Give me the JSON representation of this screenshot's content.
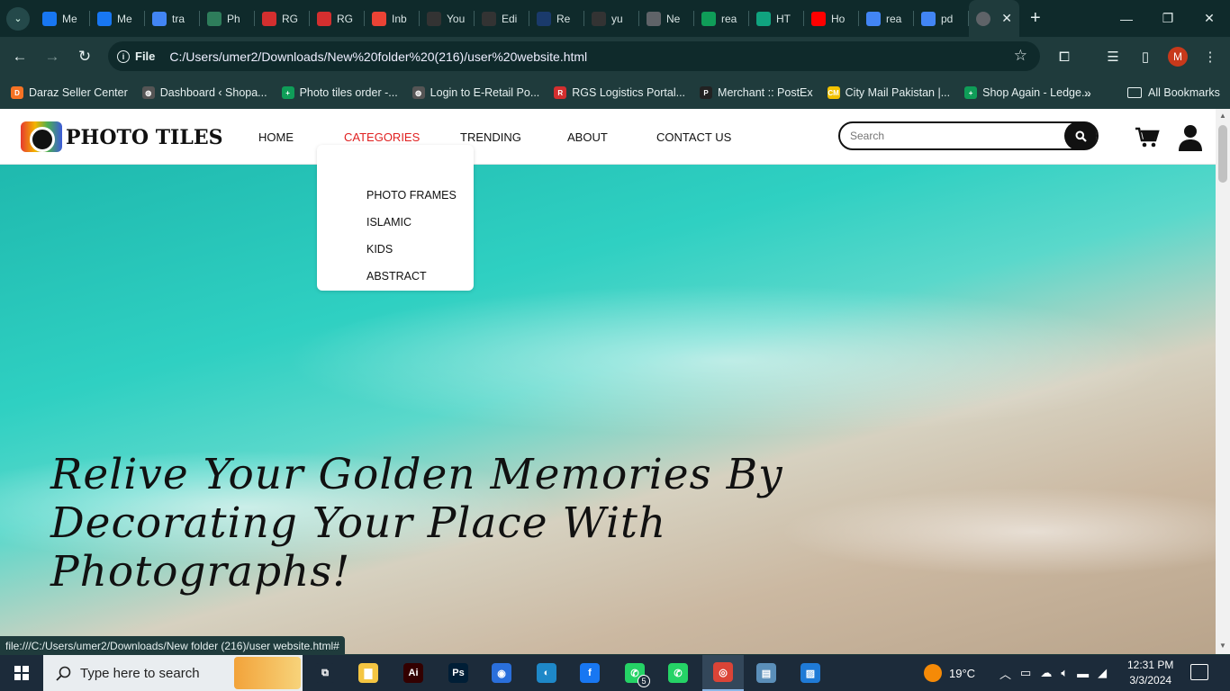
{
  "browser": {
    "tabs": [
      {
        "label": "Me",
        "icon": "meta-icon",
        "color": "#1877f2"
      },
      {
        "label": "Me",
        "icon": "meta-icon",
        "color": "#1877f2"
      },
      {
        "label": "tra",
        "icon": "google-icon",
        "color": "#4285f4"
      },
      {
        "label": "Ph",
        "icon": "site-icon",
        "color": "#2e7d5b"
      },
      {
        "label": "RG",
        "icon": "rgs-icon",
        "color": "#d32f2f"
      },
      {
        "label": "RG",
        "icon": "rgs-icon",
        "color": "#d32f2f"
      },
      {
        "label": "Inb",
        "icon": "gmail-icon",
        "color": "#ea4335"
      },
      {
        "label": "You",
        "icon": "github-icon",
        "color": "#333333"
      },
      {
        "label": "Edi",
        "icon": "github-icon",
        "color": "#333333"
      },
      {
        "label": "Re",
        "icon": "d-icon",
        "color": "#1a3a6b"
      },
      {
        "label": "yu",
        "icon": "github-icon",
        "color": "#333333"
      },
      {
        "label": "Ne",
        "icon": "chrome-icon",
        "color": "#5f6368"
      },
      {
        "label": "rea",
        "icon": "sheet-icon",
        "color": "#0f9d58"
      },
      {
        "label": "HT",
        "icon": "openai-icon",
        "color": "#10a37f"
      },
      {
        "label": "Ho",
        "icon": "youtube-icon",
        "color": "#ff0000"
      },
      {
        "label": "rea",
        "icon": "google-icon",
        "color": "#4285f4"
      },
      {
        "label": "pd",
        "icon": "google-icon",
        "color": "#4285f4"
      }
    ],
    "active_tab_icon": "globe-icon",
    "url_chip": "File",
    "url": "C:/Users/umer2/Downloads/New%20folder%20(216)/user%20website.html",
    "profile_initial": "M",
    "bookmarks": [
      {
        "label": "Daraz Seller Center",
        "color": "#f57224",
        "glyph": "D"
      },
      {
        "label": "Dashboard ‹ Shopa...",
        "color": "#555555",
        "glyph": "◍"
      },
      {
        "label": "Photo tiles order -...",
        "color": "#0f9d58",
        "glyph": "+"
      },
      {
        "label": "Login to E-Retail Po...",
        "color": "#555555",
        "glyph": "◍"
      },
      {
        "label": "RGS Logistics Portal...",
        "color": "#d32f2f",
        "glyph": "R"
      },
      {
        "label": "Merchant :: PostEx",
        "color": "#222222",
        "glyph": "P"
      },
      {
        "label": "City Mail Pakistan |...",
        "color": "#f2c200",
        "glyph": "CM"
      },
      {
        "label": "Shop Again - Ledge...",
        "color": "#0f9d58",
        "glyph": "+"
      }
    ],
    "all_bookmarks": "All Bookmarks",
    "status_url": "file:///C:/Users/umer2/Downloads/New folder (216)/user website.html#"
  },
  "site": {
    "logo_text": "PHOTO TILES",
    "nav": {
      "home": "HOME",
      "categories": "CATEGORIES",
      "trending": "TRENDING",
      "about": "ABOUT",
      "contact": "CONTACT US"
    },
    "dropdown": [
      "PHOTO FRAMES",
      "ISLAMIC",
      "KIDS",
      "ABSTRACT"
    ],
    "search_placeholder": "Search",
    "hero_text": "Relive Your Golden Memories By Decorating Your Place With Photographs!",
    "active_color": "#e02020"
  },
  "taskbar": {
    "search_placeholder": "Type here to search",
    "apps": [
      {
        "name": "task-view-icon",
        "glyph": "⧉",
        "color": "#1c2b3a"
      },
      {
        "name": "file-explorer-icon",
        "glyph": "▇",
        "color": "#f4c542"
      },
      {
        "name": "illustrator-icon",
        "glyph": "Ai",
        "color": "#330000"
      },
      {
        "name": "photoshop-icon",
        "glyph": "Ps",
        "color": "#001e36"
      },
      {
        "name": "firefox-icon",
        "glyph": "◉",
        "color": "#2a6fdb"
      },
      {
        "name": "edge-icon",
        "glyph": "◐",
        "color": "#1e88c8"
      },
      {
        "name": "facebook-icon",
        "glyph": "f",
        "color": "#1877f2"
      },
      {
        "name": "whatsapp-icon",
        "glyph": "✆",
        "color": "#25d366"
      },
      {
        "name": "whatsapp-icon-2",
        "glyph": "✆",
        "color": "#25d366"
      },
      {
        "name": "chrome-icon",
        "glyph": "◎",
        "color": "#db4437"
      },
      {
        "name": "notepad-icon",
        "glyph": "▤",
        "color": "#5b8fb9"
      },
      {
        "name": "photos-icon",
        "glyph": "▨",
        "color": "#1f7ad6"
      }
    ],
    "whatsapp_badge": "5",
    "weather": "19°C",
    "time": "12:31 PM",
    "date": "3/3/2024"
  }
}
